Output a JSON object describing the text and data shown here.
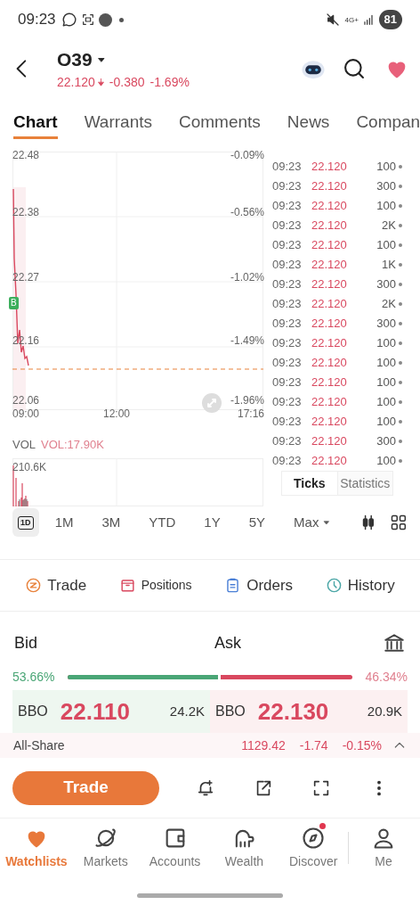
{
  "status_bar": {
    "time": "09:23",
    "network": "4G+",
    "battery": "81"
  },
  "header": {
    "symbol": "O39",
    "price": "22.120",
    "change": "-0.380",
    "change_pct": "-1.69%"
  },
  "tabs": [
    {
      "label": "Chart",
      "selected": true
    },
    {
      "label": "Warrants",
      "selected": false
    },
    {
      "label": "Comments",
      "selected": false
    },
    {
      "label": "News",
      "selected": false
    },
    {
      "label": "Compan",
      "selected": false
    }
  ],
  "chart": {
    "y_labels": [
      "22.48",
      "22.38",
      "22.27",
      "22.16",
      "22.06"
    ],
    "pct_labels": [
      "-0.09%",
      "-0.56%",
      "-1.02%",
      "-1.49%",
      "-1.96%"
    ],
    "x_labels": [
      "09:00",
      "12:00",
      "17:16"
    ],
    "marker": "B",
    "vol_label": "VOL",
    "vol_value": "VOL:17.90K",
    "vol_max": "210.6K"
  },
  "ticks": {
    "rows": [
      {
        "time": "09:23",
        "price": "22.120",
        "volume": "100"
      },
      {
        "time": "09:23",
        "price": "22.120",
        "volume": "300"
      },
      {
        "time": "09:23",
        "price": "22.120",
        "volume": "100"
      },
      {
        "time": "09:23",
        "price": "22.120",
        "volume": "2K"
      },
      {
        "time": "09:23",
        "price": "22.120",
        "volume": "100"
      },
      {
        "time": "09:23",
        "price": "22.120",
        "volume": "1K"
      },
      {
        "time": "09:23",
        "price": "22.120",
        "volume": "300"
      },
      {
        "time": "09:23",
        "price": "22.120",
        "volume": "2K"
      },
      {
        "time": "09:23",
        "price": "22.120",
        "volume": "300"
      },
      {
        "time": "09:23",
        "price": "22.120",
        "volume": "100"
      },
      {
        "time": "09:23",
        "price": "22.120",
        "volume": "100"
      },
      {
        "time": "09:23",
        "price": "22.120",
        "volume": "100"
      },
      {
        "time": "09:23",
        "price": "22.120",
        "volume": "100"
      },
      {
        "time": "09:23",
        "price": "22.120",
        "volume": "100"
      },
      {
        "time": "09:23",
        "price": "22.120",
        "volume": "300"
      },
      {
        "time": "09:23",
        "price": "22.120",
        "volume": "100"
      }
    ],
    "tabs": [
      {
        "label": "Ticks",
        "selected": true
      },
      {
        "label": "Statistics",
        "selected": false
      }
    ]
  },
  "periods": [
    {
      "label": "1D",
      "selected": true
    },
    {
      "label": "1M",
      "selected": false
    },
    {
      "label": "3M",
      "selected": false
    },
    {
      "label": "YTD",
      "selected": false
    },
    {
      "label": "1Y",
      "selected": false
    },
    {
      "label": "5Y",
      "selected": false
    },
    {
      "label": "Max",
      "selected": false
    }
  ],
  "actions": [
    {
      "kind": "trade",
      "label": "Trade"
    },
    {
      "kind": "positions",
      "label": "Positions"
    },
    {
      "kind": "orders",
      "label": "Orders"
    },
    {
      "kind": "history",
      "label": "History"
    }
  ],
  "bid_ask": {
    "bid_label": "Bid",
    "ask_label": "Ask",
    "bid_pct": "53.66%",
    "ask_pct": "46.34%",
    "level": 0.5366,
    "bid": {
      "label": "BBO",
      "price": "22.110",
      "size": "24.2K"
    },
    "ask": {
      "label": "BBO",
      "price": "22.130",
      "size": "20.9K"
    }
  },
  "index_bar": {
    "name": "All-Share",
    "value": "1129.42",
    "change": "-1.74",
    "pct": "-0.15%"
  },
  "trade_button": "Trade",
  "bottom_nav": [
    {
      "kind": "watchlists",
      "label": "Watchlists",
      "selected": true,
      "badge": false
    },
    {
      "kind": "markets",
      "label": "Markets",
      "selected": false,
      "badge": false
    },
    {
      "kind": "accounts",
      "label": "Accounts",
      "selected": false,
      "badge": false
    },
    {
      "kind": "wealth",
      "label": "Wealth",
      "selected": false,
      "badge": false
    },
    {
      "kind": "discover",
      "label": "Discover",
      "selected": false,
      "badge": true
    },
    {
      "kind": "me",
      "label": "Me",
      "selected": false,
      "badge": false
    }
  ]
}
